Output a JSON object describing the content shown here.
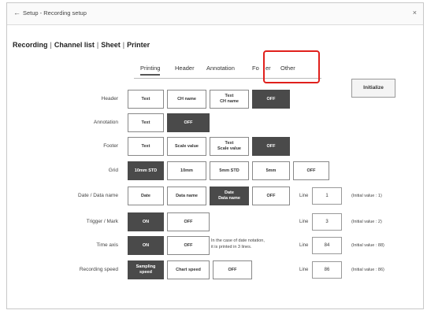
{
  "window": {
    "back_glyph": "←",
    "title": "Setup - Recording setup",
    "close_glyph": "×"
  },
  "nav": {
    "items": [
      "Recording",
      "Channel list",
      "Sheet",
      "Printer"
    ],
    "separator": "|"
  },
  "subtabs": {
    "items": [
      "Printing",
      "Header",
      "Annotation",
      "Fo",
      "er",
      "Other"
    ],
    "active": "Printing"
  },
  "initialize_label": "Initialize",
  "rows": {
    "header": {
      "label": "Header",
      "options": [
        "Text",
        "CH name",
        "Text\nCH name",
        "OFF"
      ],
      "selected": "OFF"
    },
    "annotation": {
      "label": "Annotation",
      "options": [
        "Text",
        "OFF"
      ],
      "selected": "OFF"
    },
    "footer": {
      "label": "Footer",
      "options": [
        "Text",
        "Scale value",
        "Text\nScale value",
        "OFF"
      ],
      "selected": "OFF"
    },
    "grid": {
      "label": "Grid",
      "options": [
        "10mm STD",
        "10mm",
        "5mm STD",
        "5mm",
        "OFF"
      ],
      "selected": "10mm STD"
    },
    "date": {
      "label": "Date / Data name",
      "options": [
        "Date",
        "Data name",
        "Date\nData name",
        "OFF"
      ],
      "selected": "Date\nData name",
      "line_label": "Line",
      "line_value": "1",
      "initial": "(Initial value : 1)"
    },
    "trigger": {
      "label": "Trigger / Mark",
      "options": [
        "ON",
        "OFF"
      ],
      "selected": "ON",
      "line_label": "Line",
      "line_value": "3",
      "initial": "(Initial value : 2)"
    },
    "timeaxis": {
      "label": "Time axis",
      "options": [
        "ON",
        "OFF"
      ],
      "selected": "ON",
      "note_line1": "In the case of date notation,",
      "note_line2": "it is printed in 3 lines.",
      "line_label": "Line",
      "line_value": "84",
      "initial": "(Initial value : 88)"
    },
    "speed": {
      "label": "Recording speed",
      "options": [
        "Sampling\nspeed",
        "Chart speed",
        "OFF"
      ],
      "selected": "Sampling\nspeed",
      "line_label": "Line",
      "line_value": "86",
      "initial": "(Initial value : 86)"
    }
  },
  "colors": {
    "selected_bg": "#4a4a4a",
    "highlight": "#e0201c"
  }
}
